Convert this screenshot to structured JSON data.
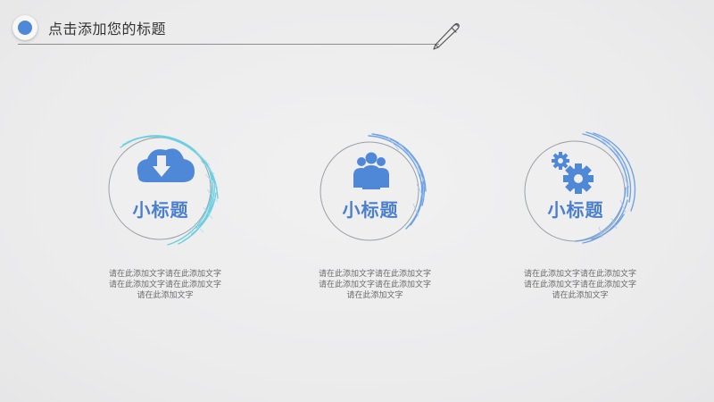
{
  "header": {
    "title": "点击添加您的标题"
  },
  "features": [
    {
      "icon": "cloud-download-icon",
      "subtitle": "小标题",
      "body": "请在此添加文字请在此添加文字请在此添加文字请在此添加文字请在此添加文字"
    },
    {
      "icon": "team-icon",
      "subtitle": "小标题",
      "body": "请在此添加文字请在此添加文字请在此添加文字请在此添加文字请在此添加文字"
    },
    {
      "icon": "gears-icon",
      "subtitle": "小标题",
      "body": "请在此添加文字请在此添加文字请在此添加文字请在此添加文字请在此添加文字"
    }
  ],
  "colors": {
    "accent_blue": "#4a7fcf",
    "accent_teal": "#6fcfe0",
    "accent_sky": "#6fa3e3"
  }
}
